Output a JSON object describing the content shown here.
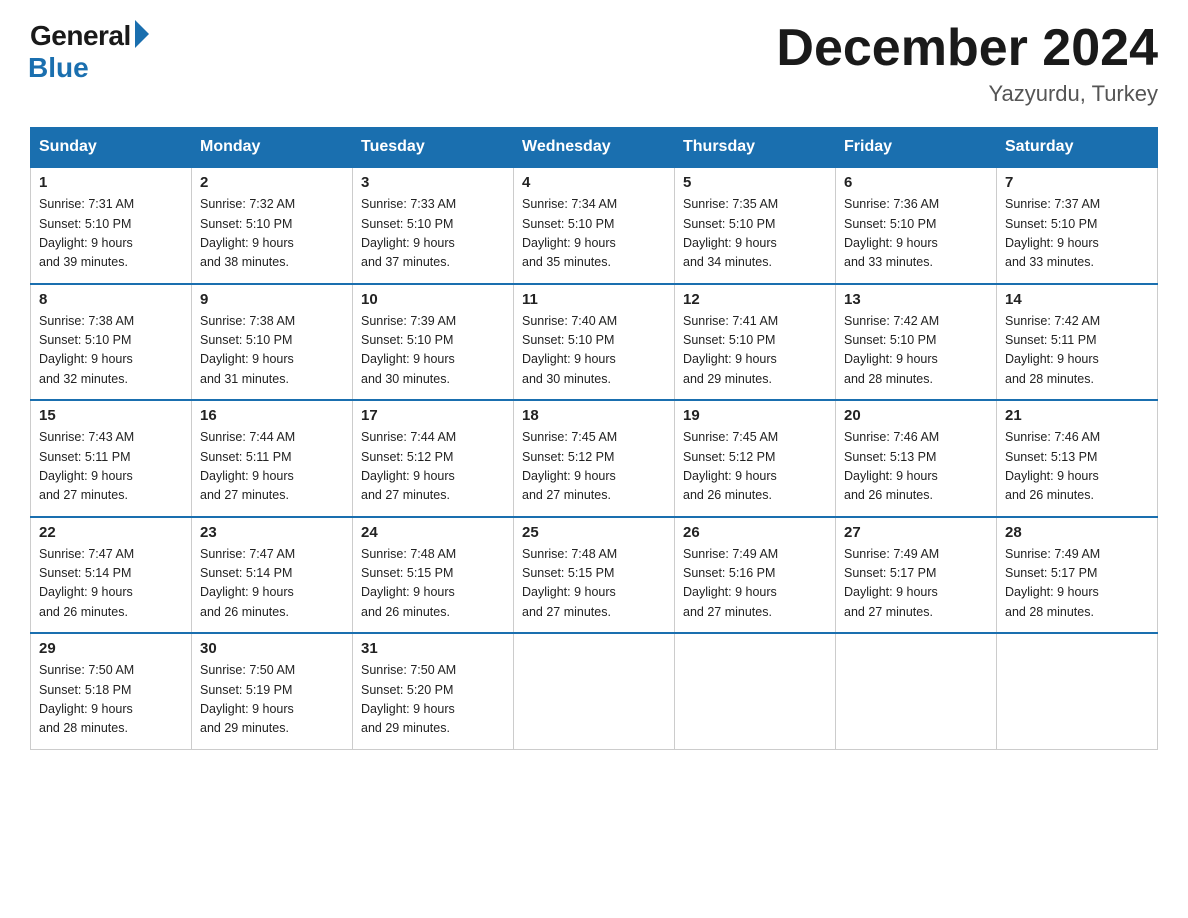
{
  "header": {
    "logo_general": "General",
    "logo_blue": "Blue",
    "month_title": "December 2024",
    "location": "Yazyurdu, Turkey"
  },
  "weekdays": [
    "Sunday",
    "Monday",
    "Tuesday",
    "Wednesday",
    "Thursday",
    "Friday",
    "Saturday"
  ],
  "weeks": [
    [
      {
        "day": "1",
        "sunrise": "7:31 AM",
        "sunset": "5:10 PM",
        "daylight": "9 hours and 39 minutes."
      },
      {
        "day": "2",
        "sunrise": "7:32 AM",
        "sunset": "5:10 PM",
        "daylight": "9 hours and 38 minutes."
      },
      {
        "day": "3",
        "sunrise": "7:33 AM",
        "sunset": "5:10 PM",
        "daylight": "9 hours and 37 minutes."
      },
      {
        "day": "4",
        "sunrise": "7:34 AM",
        "sunset": "5:10 PM",
        "daylight": "9 hours and 35 minutes."
      },
      {
        "day": "5",
        "sunrise": "7:35 AM",
        "sunset": "5:10 PM",
        "daylight": "9 hours and 34 minutes."
      },
      {
        "day": "6",
        "sunrise": "7:36 AM",
        "sunset": "5:10 PM",
        "daylight": "9 hours and 33 minutes."
      },
      {
        "day": "7",
        "sunrise": "7:37 AM",
        "sunset": "5:10 PM",
        "daylight": "9 hours and 33 minutes."
      }
    ],
    [
      {
        "day": "8",
        "sunrise": "7:38 AM",
        "sunset": "5:10 PM",
        "daylight": "9 hours and 32 minutes."
      },
      {
        "day": "9",
        "sunrise": "7:38 AM",
        "sunset": "5:10 PM",
        "daylight": "9 hours and 31 minutes."
      },
      {
        "day": "10",
        "sunrise": "7:39 AM",
        "sunset": "5:10 PM",
        "daylight": "9 hours and 30 minutes."
      },
      {
        "day": "11",
        "sunrise": "7:40 AM",
        "sunset": "5:10 PM",
        "daylight": "9 hours and 30 minutes."
      },
      {
        "day": "12",
        "sunrise": "7:41 AM",
        "sunset": "5:10 PM",
        "daylight": "9 hours and 29 minutes."
      },
      {
        "day": "13",
        "sunrise": "7:42 AM",
        "sunset": "5:10 PM",
        "daylight": "9 hours and 28 minutes."
      },
      {
        "day": "14",
        "sunrise": "7:42 AM",
        "sunset": "5:11 PM",
        "daylight": "9 hours and 28 minutes."
      }
    ],
    [
      {
        "day": "15",
        "sunrise": "7:43 AM",
        "sunset": "5:11 PM",
        "daylight": "9 hours and 27 minutes."
      },
      {
        "day": "16",
        "sunrise": "7:44 AM",
        "sunset": "5:11 PM",
        "daylight": "9 hours and 27 minutes."
      },
      {
        "day": "17",
        "sunrise": "7:44 AM",
        "sunset": "5:12 PM",
        "daylight": "9 hours and 27 minutes."
      },
      {
        "day": "18",
        "sunrise": "7:45 AM",
        "sunset": "5:12 PM",
        "daylight": "9 hours and 27 minutes."
      },
      {
        "day": "19",
        "sunrise": "7:45 AM",
        "sunset": "5:12 PM",
        "daylight": "9 hours and 26 minutes."
      },
      {
        "day": "20",
        "sunrise": "7:46 AM",
        "sunset": "5:13 PM",
        "daylight": "9 hours and 26 minutes."
      },
      {
        "day": "21",
        "sunrise": "7:46 AM",
        "sunset": "5:13 PM",
        "daylight": "9 hours and 26 minutes."
      }
    ],
    [
      {
        "day": "22",
        "sunrise": "7:47 AM",
        "sunset": "5:14 PM",
        "daylight": "9 hours and 26 minutes."
      },
      {
        "day": "23",
        "sunrise": "7:47 AM",
        "sunset": "5:14 PM",
        "daylight": "9 hours and 26 minutes."
      },
      {
        "day": "24",
        "sunrise": "7:48 AM",
        "sunset": "5:15 PM",
        "daylight": "9 hours and 26 minutes."
      },
      {
        "day": "25",
        "sunrise": "7:48 AM",
        "sunset": "5:15 PM",
        "daylight": "9 hours and 27 minutes."
      },
      {
        "day": "26",
        "sunrise": "7:49 AM",
        "sunset": "5:16 PM",
        "daylight": "9 hours and 27 minutes."
      },
      {
        "day": "27",
        "sunrise": "7:49 AM",
        "sunset": "5:17 PM",
        "daylight": "9 hours and 27 minutes."
      },
      {
        "day": "28",
        "sunrise": "7:49 AM",
        "sunset": "5:17 PM",
        "daylight": "9 hours and 28 minutes."
      }
    ],
    [
      {
        "day": "29",
        "sunrise": "7:50 AM",
        "sunset": "5:18 PM",
        "daylight": "9 hours and 28 minutes."
      },
      {
        "day": "30",
        "sunrise": "7:50 AM",
        "sunset": "5:19 PM",
        "daylight": "9 hours and 29 minutes."
      },
      {
        "day": "31",
        "sunrise": "7:50 AM",
        "sunset": "5:20 PM",
        "daylight": "9 hours and 29 minutes."
      },
      null,
      null,
      null,
      null
    ]
  ],
  "labels": {
    "sunrise_prefix": "Sunrise: ",
    "sunset_prefix": "Sunset: ",
    "daylight_prefix": "Daylight: "
  }
}
